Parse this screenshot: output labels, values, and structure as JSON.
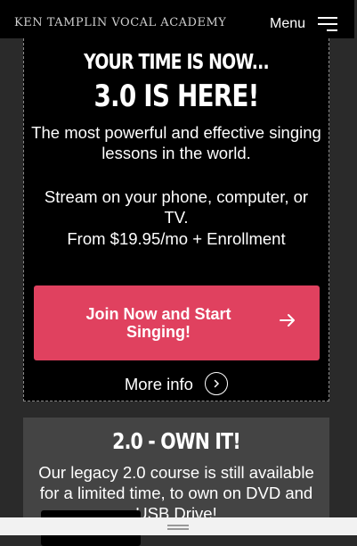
{
  "header": {
    "logo_text": "KEN TAMPLIN VOCAL ACADEMY",
    "menu_label": "Menu"
  },
  "hero": {
    "tagline": "YOUR TIME IS NOW...",
    "title": "3.0 IS HERE!",
    "description": "The most powerful and effective singing lessons in the world.",
    "stream_text": "Stream on your phone, computer, or TV.",
    "price_text": "From $19.95/mo + Enrollment",
    "cta_label": "Join Now and Start Singing!",
    "more_info_label": "More info"
  },
  "section2": {
    "title": "2.0 - OWN IT!",
    "description": "Our legacy 2.0 course is still available for a limited time, to own on DVD and USB Drive!"
  },
  "colors": {
    "cta": "#e0415f",
    "hero_bg": "#000000",
    "page_bg": "#2a2a2a",
    "section2_bg": "#444444"
  }
}
